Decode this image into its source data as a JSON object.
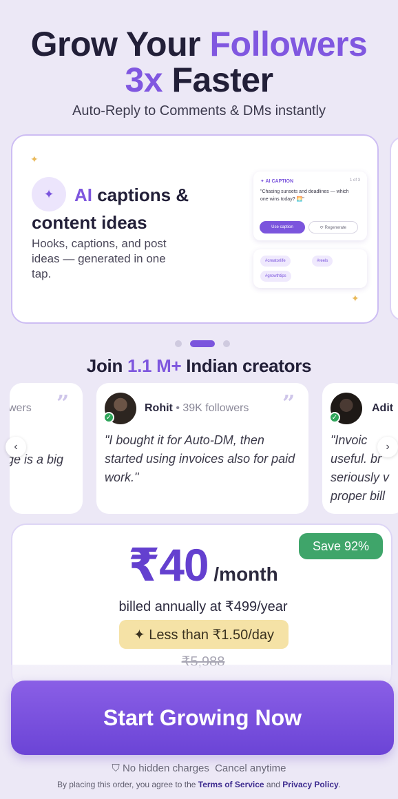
{
  "header": {
    "line1_a": "Grow Your ",
    "line1_b": "Followers",
    "line2_a": "3x",
    "line2_b": " Faster",
    "subtitle": "Auto-Reply to Comments & DMs instantly"
  },
  "feature": {
    "icon": "sparkle-icon",
    "title_ai": "AI",
    "title_rest": " captions & content ideas",
    "description": "Hooks, captions, and post ideas — generated in one tap.",
    "mock": {
      "label": "✦ AI CAPTION",
      "count": "1 of 3",
      "caption": "\"Chasing sunsets and deadlines — which one wins today? 🌅\"",
      "use_button": "Use caption",
      "regen_button": "⟳ Regenerate",
      "tags": [
        "#creatorlife",
        "#reels",
        "#growthtips"
      ]
    }
  },
  "carousel": {
    "active_index": 1,
    "count": 3
  },
  "social_proof": {
    "prefix": "Join ",
    "highlight": "1.1 M+",
    "suffix": " Indian creators"
  },
  "testimonials": [
    {
      "name": "",
      "followers": "wers",
      "quote": "ge is a big"
    },
    {
      "name": "Rohit",
      "followers": " • 39K followers",
      "quote": "\"I bought it for Auto-DM, then started using invoices also for paid work.\""
    },
    {
      "name": "Adit",
      "followers": "",
      "quote": "\"Invoic useful. br seriously v proper bill"
    }
  ],
  "pricing": {
    "save_badge": "Save 92%",
    "price": "₹40",
    "per": " /month",
    "billed": "billed annually at ₹499/year",
    "per_day": "✦ Less than ₹1.50/day",
    "original": "₹5,988"
  },
  "cta": {
    "label": "Start Growing Now",
    "assurance_1": "No hidden charges",
    "assurance_2": "Cancel anytime",
    "legal_prefix": "By placing this order, you agree to the ",
    "terms": "Terms of Service",
    "legal_and": " and ",
    "privacy": "Privacy Policy",
    "legal_end": "."
  },
  "colors": {
    "accent": "#8057e0",
    "background": "#ece8f6",
    "save_green": "#3fa56a",
    "per_day_yellow": "#f5e2a6"
  }
}
